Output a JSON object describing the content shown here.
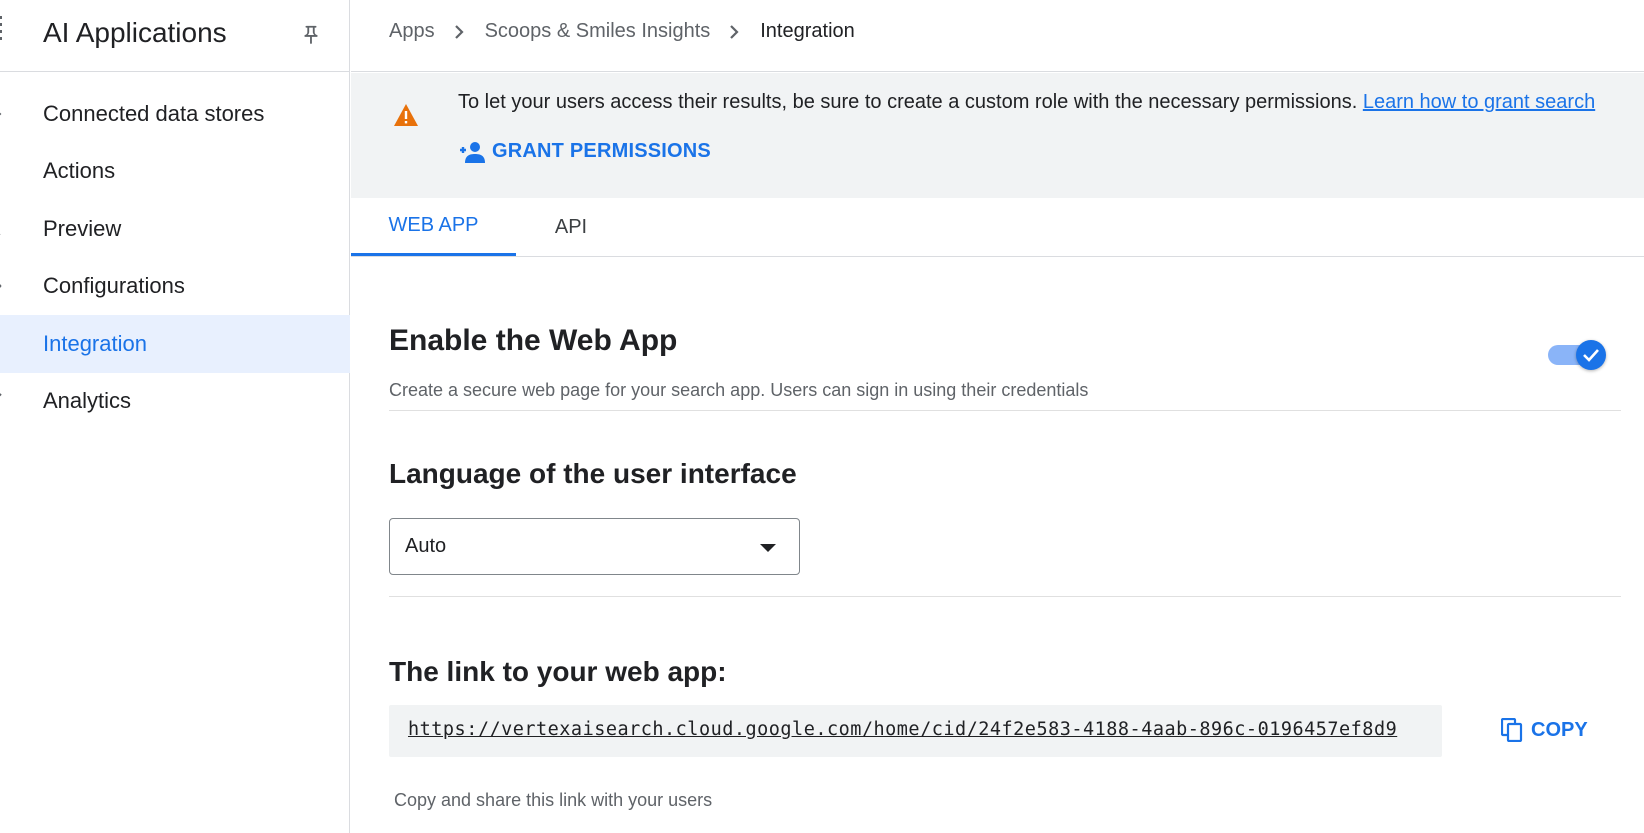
{
  "sidebar": {
    "title": "AI Applications",
    "items": [
      {
        "label": "Connected data stores",
        "icon": "database-icon",
        "active": false
      },
      {
        "label": "Actions",
        "icon": "actions-icon",
        "active": false
      },
      {
        "label": "Preview",
        "icon": "preview-icon",
        "active": false
      },
      {
        "label": "Configurations",
        "icon": "config-icon",
        "active": false
      },
      {
        "label": "Integration",
        "icon": "integration-icon",
        "active": true
      },
      {
        "label": "Analytics",
        "icon": "analytics-icon",
        "active": false
      }
    ]
  },
  "breadcrumb": {
    "items": [
      "Apps",
      "Scoops & Smiles Insights",
      "Integration"
    ]
  },
  "banner": {
    "message": "To let your users access their results, be sure to create a custom role with the necessary permissions. ",
    "link": "Learn how to grant search",
    "button": "GRANT PERMISSIONS",
    "icon": "warning-icon"
  },
  "tabs": [
    {
      "label": "WEB APP",
      "active": true
    },
    {
      "label": "API",
      "active": false
    }
  ],
  "main": {
    "enable_title": "Enable the Web App",
    "enable_desc": "Create a secure web page for your search app. Users can sign in using their credentials",
    "enabled": true,
    "language_title": "Language of the user interface",
    "language_value": "Auto",
    "link_title": "The link to your web app:",
    "link_url": "https://vertexaisearch.cloud.google.com/home/cid/24f2e583-4188-4aab-896c-0196457ef8d9",
    "copy_label": "COPY",
    "copy_hint": "Copy and share this link with your users"
  },
  "colors": {
    "accent": "#1a73e8",
    "warning": "#e8710a",
    "active_bg": "#e8f0fe",
    "banner_bg": "#f1f3f4"
  }
}
